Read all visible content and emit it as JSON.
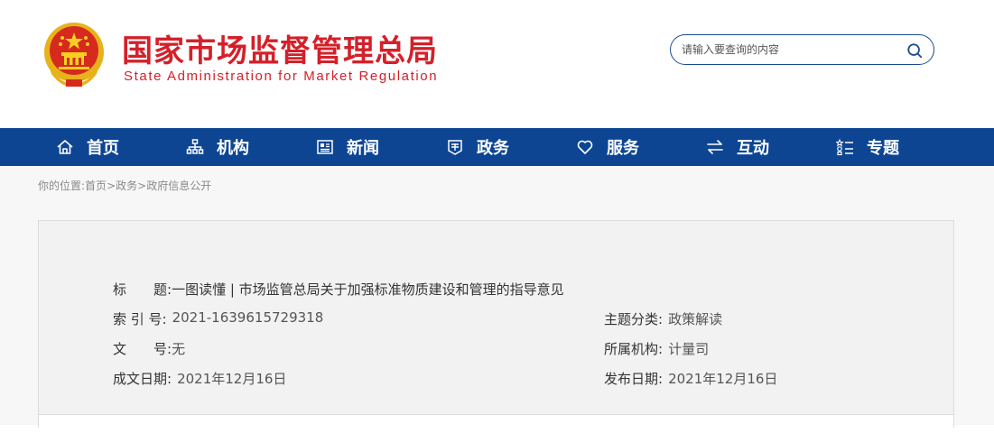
{
  "header": {
    "title_cn": "国家市场监督管理总局",
    "title_en": "State Administration for Market Regulation",
    "brand_color": "#d4202a"
  },
  "search": {
    "placeholder": "请输入要查询的内容",
    "icon": "search-icon"
  },
  "nav": {
    "background": "#0d4593",
    "items": [
      {
        "label": "首页",
        "icon": "home-icon"
      },
      {
        "label": "机构",
        "icon": "org-chart-icon"
      },
      {
        "label": "新闻",
        "icon": "news-icon"
      },
      {
        "label": "政务",
        "icon": "gov-affairs-icon"
      },
      {
        "label": "服务",
        "icon": "heart-icon"
      },
      {
        "label": "互动",
        "icon": "exchange-icon"
      },
      {
        "label": "专题",
        "icon": "topic-list-icon"
      }
    ]
  },
  "breadcrumb": {
    "prefix": "你的位置:",
    "items": [
      "首页",
      "政务",
      "政府信息公开"
    ],
    "separator": ">"
  },
  "info": {
    "title_label": "标　　题:",
    "title_value": "一图读懂 | 市场监管总局关于加强标准物质建设和管理的指导意见",
    "index_label": "索 引 号:",
    "index_value": "2021-1639615729318",
    "doc_no_label": "文　　号:",
    "doc_no_value": "无",
    "date_label": "成文日期:",
    "date_value": "2021年12月16日",
    "category_label": "主题分类:",
    "category_value": "政策解读",
    "agency_label": "所属机构:",
    "agency_value": "计量司",
    "publish_label": "发布日期:",
    "publish_value": "2021年12月16日"
  }
}
